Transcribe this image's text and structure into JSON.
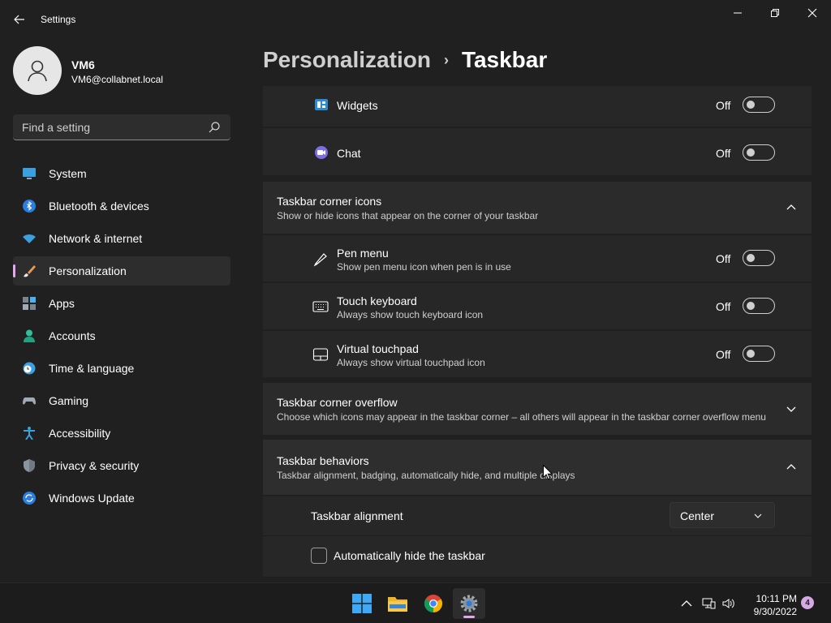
{
  "window": {
    "title": "Settings"
  },
  "profile": {
    "name": "VM6",
    "email": "VM6@collabnet.local"
  },
  "search": {
    "placeholder": "Find a setting"
  },
  "sidebar": {
    "items": [
      {
        "label": "System",
        "icon": "monitor-icon"
      },
      {
        "label": "Bluetooth & devices",
        "icon": "bluetooth-icon"
      },
      {
        "label": "Network & internet",
        "icon": "wifi-icon"
      },
      {
        "label": "Personalization",
        "icon": "brush-icon",
        "selected": true
      },
      {
        "label": "Apps",
        "icon": "apps-icon"
      },
      {
        "label": "Accounts",
        "icon": "person-icon"
      },
      {
        "label": "Time & language",
        "icon": "clock-globe-icon"
      },
      {
        "label": "Gaming",
        "icon": "gamepad-icon"
      },
      {
        "label": "Accessibility",
        "icon": "accessibility-icon"
      },
      {
        "label": "Privacy & security",
        "icon": "shield-icon"
      },
      {
        "label": "Windows Update",
        "icon": "update-icon"
      }
    ]
  },
  "breadcrumb": {
    "parent": "Personalization",
    "separator": "›",
    "current": "Taskbar"
  },
  "taskbar_items": {
    "widgets": {
      "label": "Widgets",
      "state": "Off"
    },
    "chat": {
      "label": "Chat",
      "state": "Off"
    }
  },
  "corner_icons": {
    "title": "Taskbar corner icons",
    "subtitle": "Show or hide icons that appear on the corner of your taskbar",
    "items": [
      {
        "label": "Pen menu",
        "sub": "Show pen menu icon when pen is in use",
        "state": "Off"
      },
      {
        "label": "Touch keyboard",
        "sub": "Always show touch keyboard icon",
        "state": "Off"
      },
      {
        "label": "Virtual touchpad",
        "sub": "Always show virtual touchpad icon",
        "state": "Off"
      }
    ]
  },
  "corner_overflow": {
    "title": "Taskbar corner overflow",
    "subtitle": "Choose which icons may appear in the taskbar corner – all others will appear in the taskbar corner overflow menu"
  },
  "behaviors": {
    "title": "Taskbar behaviors",
    "subtitle": "Taskbar alignment, badging, automatically hide, and multiple displays",
    "alignment_label": "Taskbar alignment",
    "alignment_value": "Center",
    "autohide_label": "Automatically hide the taskbar",
    "autohide_checked": false
  },
  "system_taskbar": {
    "time": "10:11 PM",
    "date": "9/30/2022",
    "notification_count": "4"
  },
  "colors": {
    "accent": "#e8a5f0",
    "background": "#202020",
    "card": "#2b2b2b"
  }
}
